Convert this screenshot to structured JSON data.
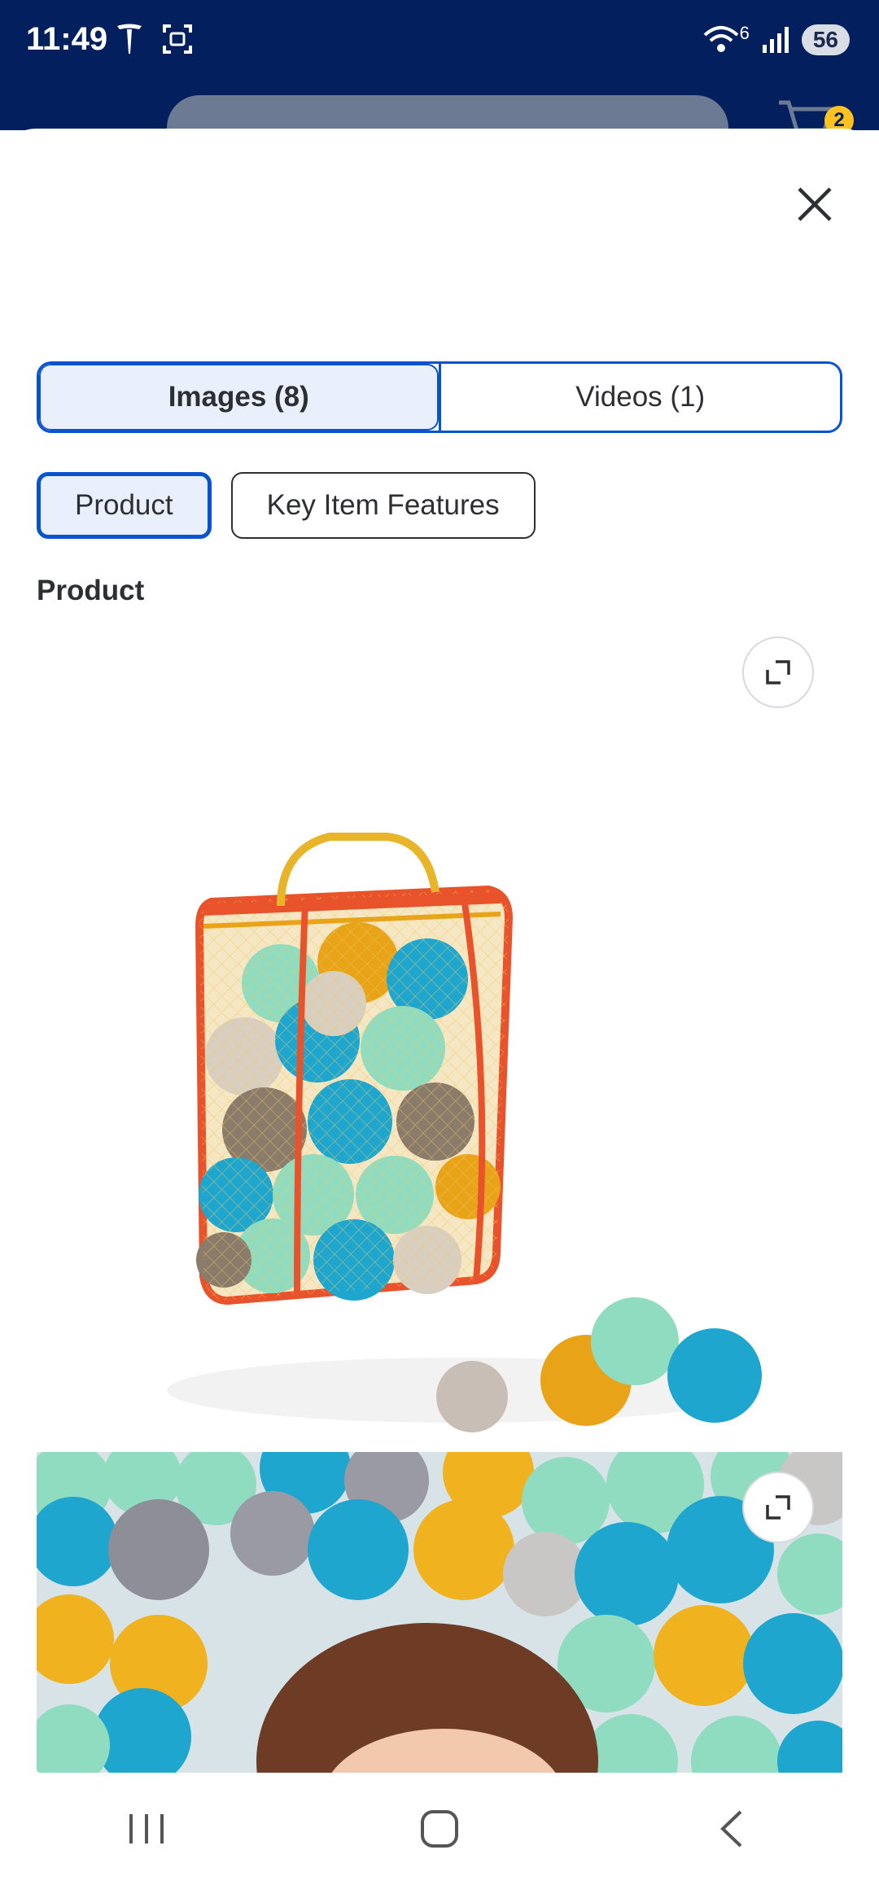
{
  "status_bar": {
    "time": "11:49",
    "network": "6",
    "battery": "56"
  },
  "header": {
    "cart_count": "2"
  },
  "tabs": [
    {
      "label": "Images (8)",
      "active": true
    },
    {
      "label": "Videos (1)",
      "active": false
    }
  ],
  "chips": [
    {
      "label": "Product",
      "active": true
    },
    {
      "label": "Key Item Features",
      "active": false
    }
  ],
  "section": {
    "title": "Product"
  },
  "colors": {
    "accent": "#0a53ce",
    "header_bg": "#041f5e",
    "active_bg": "#e9f0fc"
  },
  "icons": [
    "close-icon",
    "expand-icon",
    "wifi-icon",
    "signal-icon",
    "cart-icon",
    "recent-apps-icon",
    "home-icon",
    "back-icon"
  ]
}
